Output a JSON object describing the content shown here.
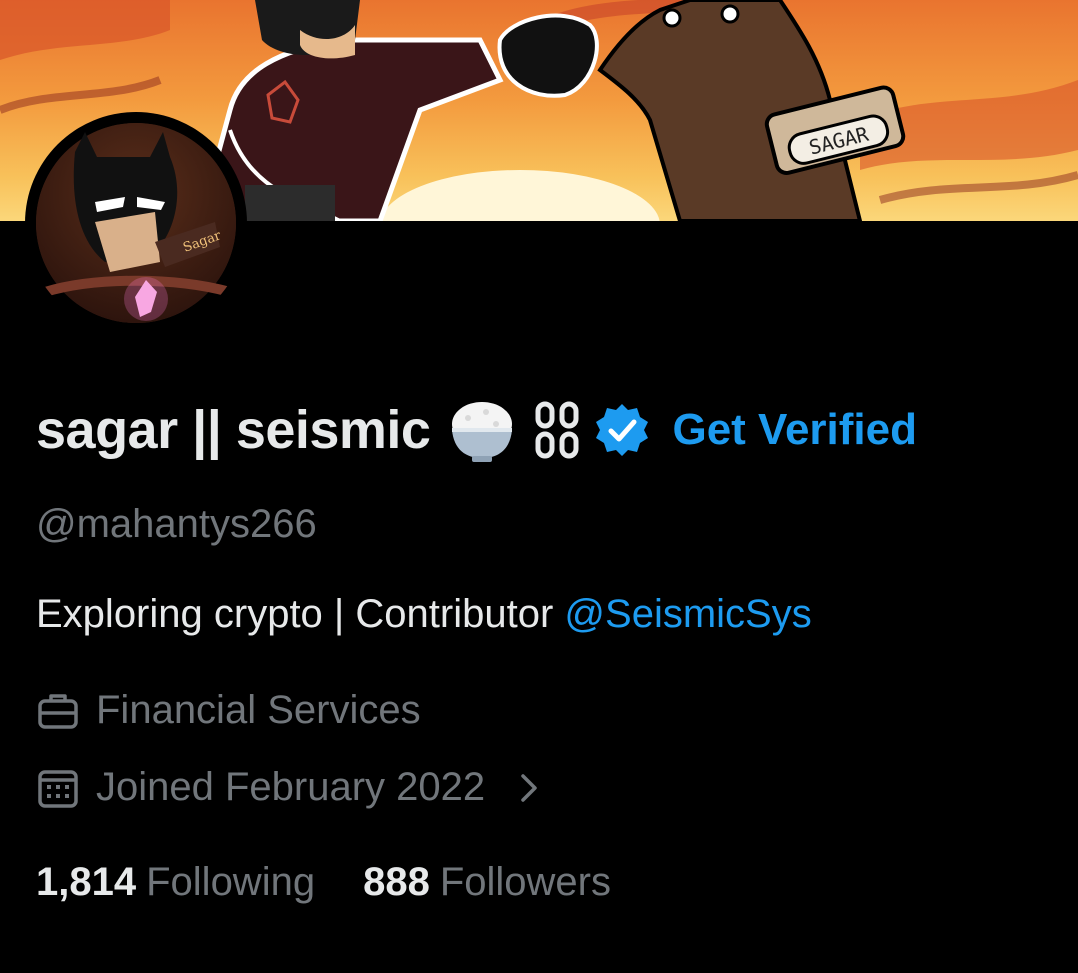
{
  "profile": {
    "display_name": "sagar || seismic",
    "handle": "@mahantys266",
    "get_verified_label": "Get Verified",
    "bio": {
      "text": "Exploring crypto | Contributor",
      "mention": "@SeismicSys"
    },
    "category": "Financial Services",
    "joined": "Joined February 2022",
    "following_count": "1,814",
    "following_label": "Following",
    "followers_count": "888",
    "followers_label": "Followers"
  },
  "banner": {
    "sign_text": "SAGAR"
  },
  "avatar": {
    "signature_text": "Sagar"
  },
  "icons": {
    "name_emoji": "rice-bowl-icon",
    "name_symbol": "chain-link-icon",
    "verified": "verified-badge-icon",
    "category": "briefcase-icon",
    "joined": "calendar-icon",
    "joined_more": "chevron-right-icon"
  },
  "colors": {
    "background": "#000000",
    "text_primary": "#e7e9ea",
    "text_secondary": "#71767b",
    "accent": "#1d9bf0"
  }
}
